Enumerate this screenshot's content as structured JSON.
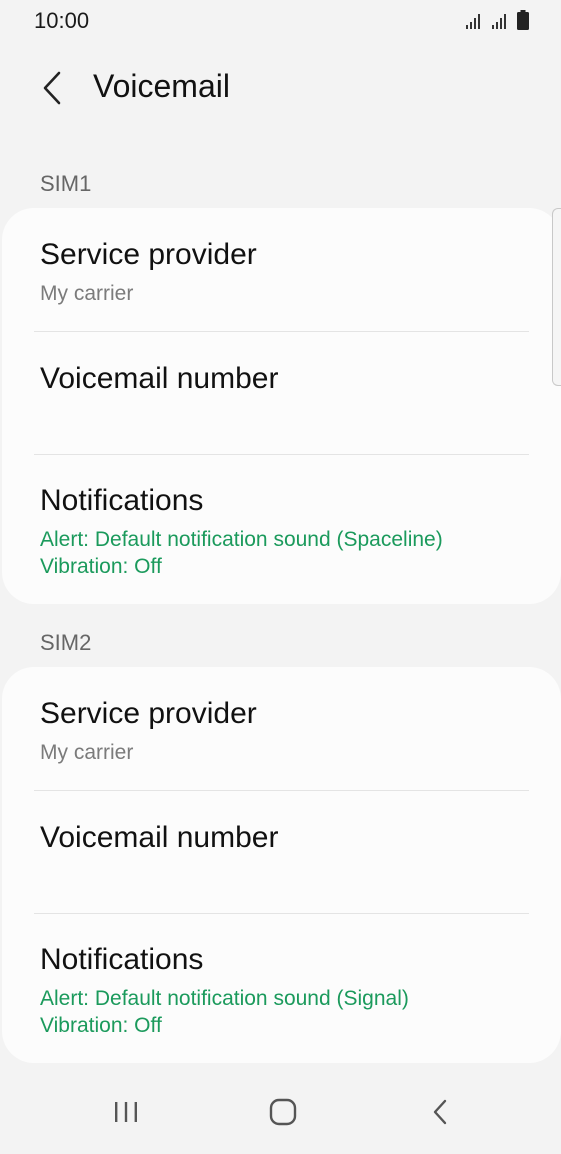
{
  "status_bar": {
    "time": "10:00",
    "icons": [
      "signal-sim1-icon",
      "signal-sim2-icon",
      "battery-icon"
    ]
  },
  "header": {
    "title": "Voicemail",
    "back_icon": "back-arrow-icon"
  },
  "sim1": {
    "label": "SIM1",
    "service_provider": {
      "title": "Service provider",
      "value": "My carrier"
    },
    "voicemail_number": {
      "title": "Voicemail number"
    },
    "notifications": {
      "title": "Notifications",
      "alert": "Alert: Default notification sound (Spaceline)",
      "vibration": "Vibration: Off"
    }
  },
  "sim2": {
    "label": "SIM2",
    "service_provider": {
      "title": "Service provider",
      "value": "My carrier"
    },
    "voicemail_number": {
      "title": "Voicemail number"
    },
    "notifications": {
      "title": "Notifications",
      "alert": "Alert: Default notification sound (Signal)",
      "vibration": "Vibration: Off"
    }
  },
  "nav_bar": {
    "icons": [
      "recent-apps-icon",
      "home-icon",
      "back-icon"
    ]
  },
  "colors": {
    "accent_green": "#1b9a5c",
    "background": "#f3f3f3",
    "card": "#fcfcfc"
  }
}
